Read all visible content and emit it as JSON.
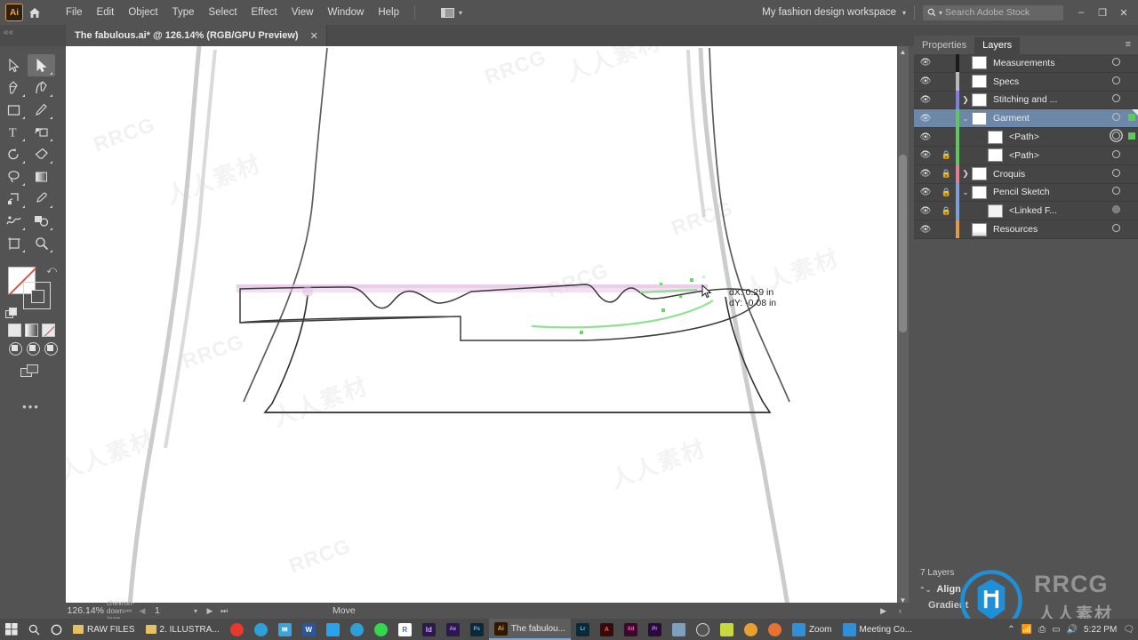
{
  "app": {
    "logo_label": "Ai",
    "home_icon": "home-icon"
  },
  "menubar": {
    "items": [
      "File",
      "Edit",
      "Object",
      "Type",
      "Select",
      "Effect",
      "View",
      "Window",
      "Help"
    ],
    "arrange_icon": "arrange-documents-icon",
    "workspace": "My fashion design workspace",
    "workspace_chevron": "chevron-down-icon",
    "search": {
      "icon": "search-icon",
      "placeholder": "Search Adobe Stock",
      "value": ""
    },
    "window_buttons": {
      "minimize": "–",
      "restore": "❐",
      "close": "✕"
    }
  },
  "tabbar": {
    "collapse": "««",
    "document_title": "The fabulous.ai* @ 126.14% (RGB/GPU Preview)",
    "close": "✕"
  },
  "toolbar": {
    "tools": [
      "selection-tool",
      "direct-selection-tool",
      "pen-tool",
      "curvature-tool",
      "rectangle-tool",
      "pencil-tool",
      "type-tool",
      "shape-builder-tool",
      "rotate-tool",
      "eraser-tool",
      "lasso-tool",
      "gradient-tool",
      "scale-tool",
      "eyedropper-tool",
      "warp-tool",
      "blend-tool",
      "artboard-tool",
      "zoom-tool"
    ],
    "active_tool": "direct-selection-tool",
    "fill_label": "fill-swatch-none",
    "stroke_label": "stroke-swatch",
    "swap_icon": "swap-fill-stroke-icon",
    "default_icon": "default-fill-stroke-icon",
    "color_modes": [
      "color-mode",
      "gradient-mode",
      "none-mode"
    ],
    "draw_modes": [
      "draw-normal",
      "draw-behind",
      "draw-inside"
    ],
    "screen_mode": "change-screen-mode-icon",
    "more_tools": "•••"
  },
  "canvas": {
    "tooltip": {
      "dx": "dX: 0.29 in",
      "dy": "dY: -0.08 in"
    },
    "watermarks": [
      "RRCG",
      "人人素材"
    ],
    "cursor": "direct-selection-cursor"
  },
  "statusbar": {
    "zoom": "126.14%",
    "zoom_chevron": "chevron-down-icon",
    "nav_first": "⏮",
    "nav_prev": "◀",
    "page": "1",
    "page_chevron": "chevron-down-icon",
    "nav_next": "▶",
    "nav_last": "⏭",
    "status_text": "Move",
    "status_play": "▶",
    "status_more": "‹"
  },
  "panel": {
    "tabs": [
      {
        "label": "Properties",
        "active": false
      },
      {
        "label": "Layers",
        "active": true
      }
    ],
    "menu_icon": "panel-menu-icon",
    "layers": [
      {
        "name": "Measurements",
        "color": "#1a1a1a",
        "visible": true,
        "locked": false,
        "twisty": "none",
        "indent": 0,
        "selected": false,
        "target": "circle",
        "has_selection_square": false
      },
      {
        "name": "Specs",
        "color": "#b9b9b9",
        "visible": true,
        "locked": false,
        "twisty": "none",
        "indent": 0,
        "selected": false,
        "target": "circle",
        "has_selection_square": false
      },
      {
        "name": "Stitching and ...",
        "color": "#7f7fe0",
        "visible": true,
        "locked": false,
        "twisty": "right",
        "indent": 0,
        "selected": false,
        "target": "circle",
        "has_selection_square": false
      },
      {
        "name": "Garment",
        "color": "#5ec75e",
        "visible": true,
        "locked": false,
        "twisty": "down",
        "indent": 0,
        "selected": true,
        "target": "circle",
        "has_selection_square": true
      },
      {
        "name": "<Path>",
        "color": "#5ec75e",
        "visible": true,
        "locked": false,
        "twisty": "none",
        "indent": 1,
        "selected": false,
        "target": "double",
        "has_selection_square": true
      },
      {
        "name": "<Path>",
        "color": "#5ec75e",
        "visible": true,
        "locked": true,
        "twisty": "none",
        "indent": 1,
        "selected": false,
        "target": "circle",
        "has_selection_square": false
      },
      {
        "name": "Croquis",
        "color": "#e07f8f",
        "visible": true,
        "locked": true,
        "twisty": "right",
        "indent": 0,
        "selected": false,
        "target": "circle",
        "has_selection_square": false
      },
      {
        "name": "Pencil Sketch",
        "color": "#7f9fd8",
        "visible": true,
        "locked": true,
        "twisty": "down",
        "indent": 0,
        "selected": false,
        "target": "circle",
        "has_selection_square": false
      },
      {
        "name": "<Linked F...",
        "color": "#7f9fd8",
        "visible": true,
        "locked": true,
        "twisty": "none",
        "indent": 1,
        "selected": false,
        "target": "dim",
        "has_selection_square": false
      },
      {
        "name": "Resources",
        "color": "#e09a4a",
        "visible": true,
        "locked": false,
        "twisty": "none",
        "indent": 0,
        "selected": false,
        "target": "circle",
        "has_selection_square": false
      }
    ],
    "layer_count": "7 Layers",
    "collapsed_panels": [
      {
        "label": "Align",
        "icon": "panel-expand-icon"
      },
      {
        "label": "Gradient",
        "icon": "panel-expand-icon"
      }
    ],
    "watermark_text": "RRCG",
    "watermark_cn": "人人素材"
  },
  "taskbar": {
    "start_icon": "windows-start-icon",
    "search_icon": "search-icon",
    "cortana_icon": "cortana-icon",
    "items": [
      {
        "label": "RAW FILES",
        "icon": "folder-icon",
        "type": "folder"
      },
      {
        "label": "2. ILLUSTRA...",
        "icon": "folder-icon",
        "type": "folder"
      },
      {
        "label": "",
        "icon": "opera-icon",
        "color": "#e8392f"
      },
      {
        "label": "",
        "icon": "edge-icon",
        "color": "#2f9fd8"
      },
      {
        "label": "",
        "icon": "mail-icon",
        "color": "#3ba3dd"
      },
      {
        "label": "",
        "icon": "word-icon",
        "color": "#2b579a"
      },
      {
        "label": "",
        "icon": "twitter-icon",
        "color": "#2aa3ef"
      },
      {
        "label": "",
        "icon": "telegram-icon",
        "color": "#2f9fd8"
      },
      {
        "label": "",
        "icon": "whatsapp-icon",
        "color": "#35d74f"
      },
      {
        "label": "",
        "icon": "flaticon-icon",
        "color": "#ffffff"
      },
      {
        "label": "",
        "icon": "indesign-icon",
        "color": "#49218a"
      },
      {
        "label": "",
        "icon": "aftereffects-icon",
        "color": "#9a5bd8"
      },
      {
        "label": "",
        "icon": "photoshop-icon",
        "color": "#1f7fa8"
      },
      {
        "label": "The fabulou...",
        "icon": "illustrator-icon",
        "color": "#e8821e",
        "active": true
      },
      {
        "label": "",
        "icon": "lightroom-icon",
        "color": "#3f9fd8"
      },
      {
        "label": "",
        "icon": "acrobat-icon",
        "color": "#d8392f"
      },
      {
        "label": "",
        "icon": "xd-icon",
        "color": "#d82f8f"
      },
      {
        "label": "",
        "icon": "premiere-icon",
        "color": "#9a3fd8"
      },
      {
        "label": "",
        "icon": "books-icon",
        "color": "#6f9fbf"
      },
      {
        "label": "",
        "icon": "globe-icon",
        "color": "#cfcfcf"
      },
      {
        "label": "",
        "icon": "dropbox-icon",
        "color": "#c8d83f"
      },
      {
        "label": "",
        "icon": "chrome-icon",
        "color": "#e8a02f"
      },
      {
        "label": "",
        "icon": "firefox-icon",
        "color": "#e8712f"
      },
      {
        "label": "Zoom",
        "icon": "zoom-app-icon",
        "color": "#2f8fd8"
      },
      {
        "label": "Meeting Co...",
        "icon": "zoom-app-icon",
        "color": "#2f8fd8"
      }
    ],
    "tray": {
      "chevron": "show-hidden-icons-icon",
      "network": "wifi-icon",
      "usb": "usb-icon",
      "battery": "battery-icon",
      "volume": "volume-icon",
      "time": "5:22 PM",
      "notify": "notifications-icon"
    }
  },
  "colors": {
    "chrome": "#535353",
    "panel": "#454545",
    "selection": "#6c87a8",
    "accent_green": "#5ec75e"
  }
}
